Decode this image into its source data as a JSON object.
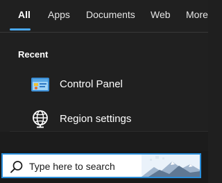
{
  "tabs": [
    {
      "label": "All",
      "active": true
    },
    {
      "label": "Apps",
      "active": false
    },
    {
      "label": "Documents",
      "active": false
    },
    {
      "label": "Web",
      "active": false
    },
    {
      "label": "More",
      "active": false
    }
  ],
  "recent": {
    "title": "Recent",
    "items": [
      {
        "label": "Control Panel",
        "icon": "control-panel-icon"
      },
      {
        "label": "Region settings",
        "icon": "globe-icon"
      }
    ]
  },
  "search": {
    "placeholder": "Type here to search",
    "icon": "search-icon"
  },
  "colors": {
    "accent": "#2a8fdc",
    "tab_underline": "#4aa8f0",
    "background": "#202020"
  }
}
